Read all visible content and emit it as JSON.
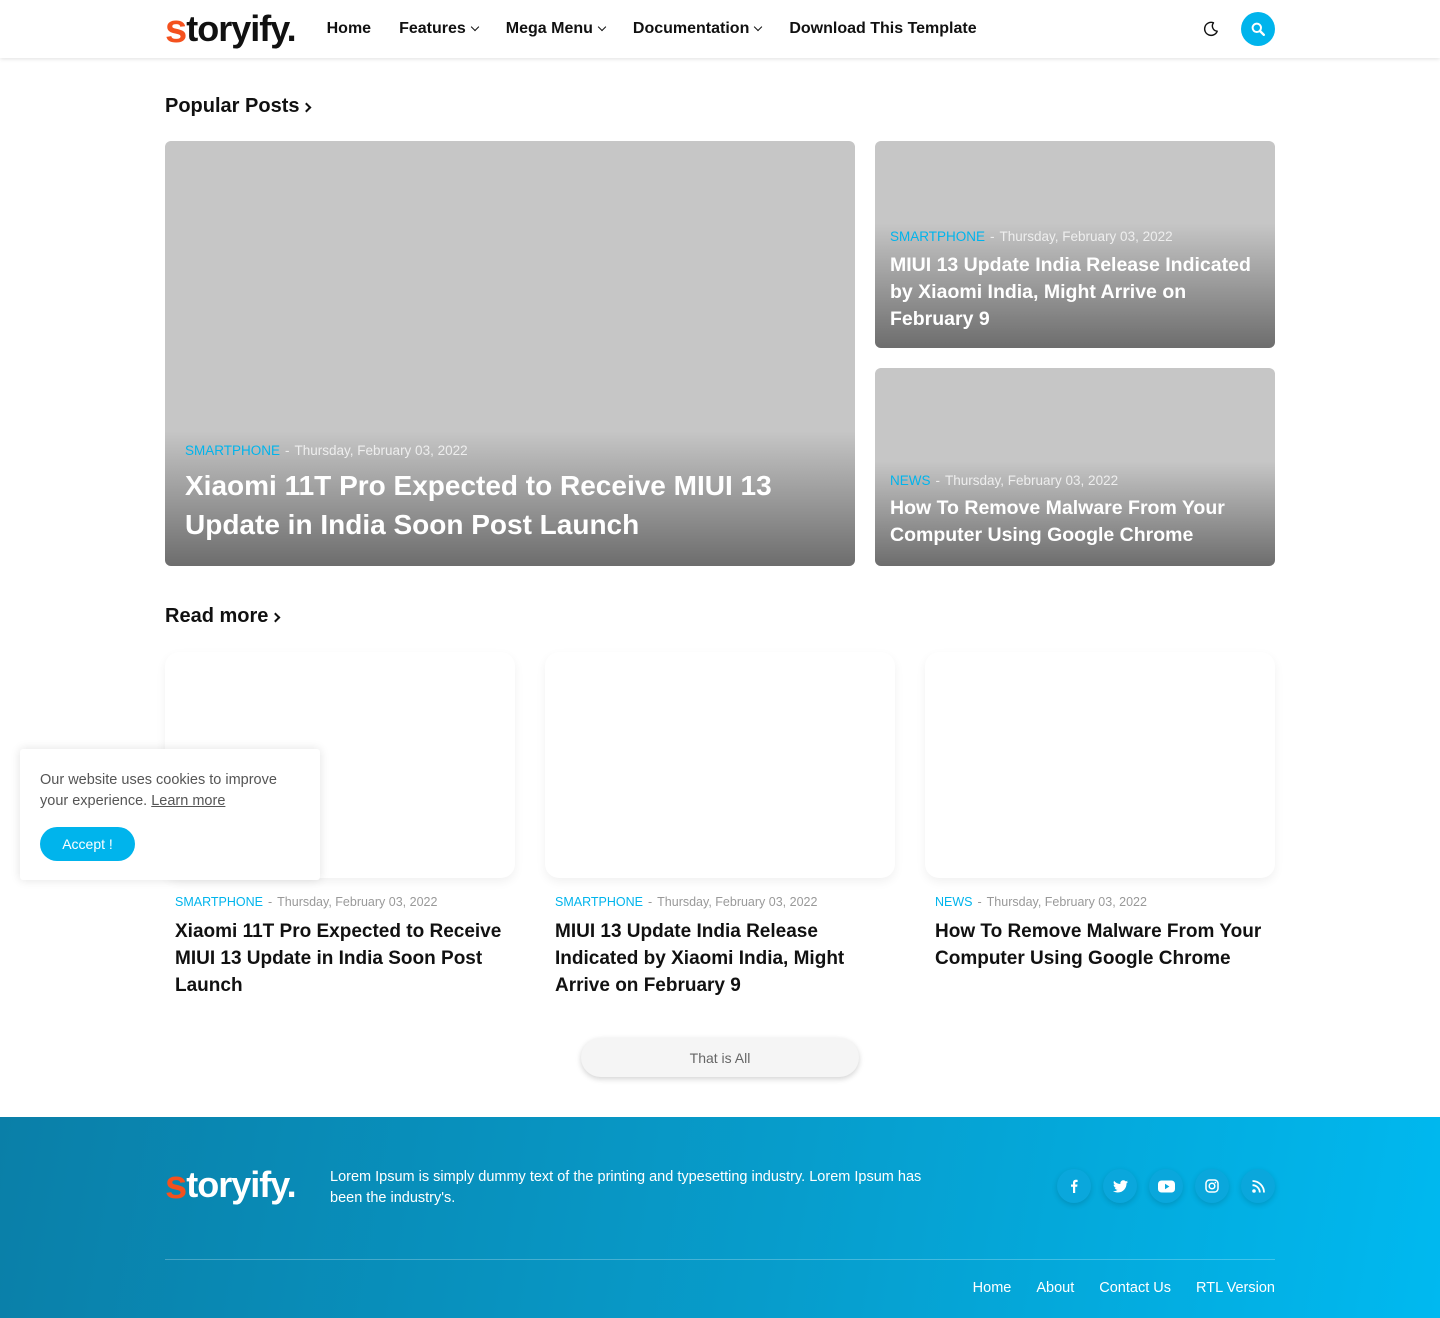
{
  "header": {
    "logo_first": "s",
    "logo_rest": "toryify.",
    "nav": [
      {
        "label": "Home",
        "dropdown": false
      },
      {
        "label": "Features",
        "dropdown": true
      },
      {
        "label": "Mega Menu",
        "dropdown": true
      },
      {
        "label": "Documentation",
        "dropdown": true
      },
      {
        "label": "Download This Template",
        "dropdown": false
      }
    ],
    "icons": {
      "theme": "moon-icon",
      "search": "search-icon"
    },
    "accent": "#00b4ec"
  },
  "popular": {
    "title": "Popular Posts",
    "posts": [
      {
        "category": "SMARTPHONE",
        "date": "Thursday, February 03, 2022",
        "title": "Xiaomi 11T Pro Expected to Receive MIUI 13 Update in India Soon Post Launch"
      },
      {
        "category": "SMARTPHONE",
        "date": "Thursday, February 03, 2022",
        "title": "MIUI 13 Update India Release Indicated by Xiaomi India, Might Arrive on February 9"
      },
      {
        "category": "NEWS",
        "date": "Thursday, February 03, 2022",
        "title": "How To Remove Malware From Your Computer Using Google Chrome"
      }
    ]
  },
  "readmore": {
    "title": "Read more",
    "posts": [
      {
        "category": "SMARTPHONE",
        "date": "Thursday, February 03, 2022",
        "title": "Xiaomi 11T Pro Expected to Receive MIUI 13 Update in India Soon Post Launch"
      },
      {
        "category": "SMARTPHONE",
        "date": "Thursday, February 03, 2022",
        "title": "MIUI 13 Update India Release Indicated by Xiaomi India, Might Arrive on February 9"
      },
      {
        "category": "NEWS",
        "date": "Thursday, February 03, 2022",
        "title": "How To Remove Malware From Your Computer Using Google Chrome"
      }
    ],
    "end_label": "That is All"
  },
  "cookie": {
    "text": "Our website uses cookies to improve your experience.",
    "link": "Learn more",
    "button": "Accept !"
  },
  "footer": {
    "logo_first": "s",
    "logo_rest": "toryify.",
    "text": "Lorem Ipsum is simply dummy text of the printing and typesetting industry. Lorem Ipsum has been the industry's.",
    "socials": [
      "facebook-icon",
      "twitter-icon",
      "youtube-icon",
      "instagram-icon",
      "rss-icon"
    ],
    "links": [
      "Home",
      "About",
      "Contact Us",
      "RTL Version"
    ]
  }
}
